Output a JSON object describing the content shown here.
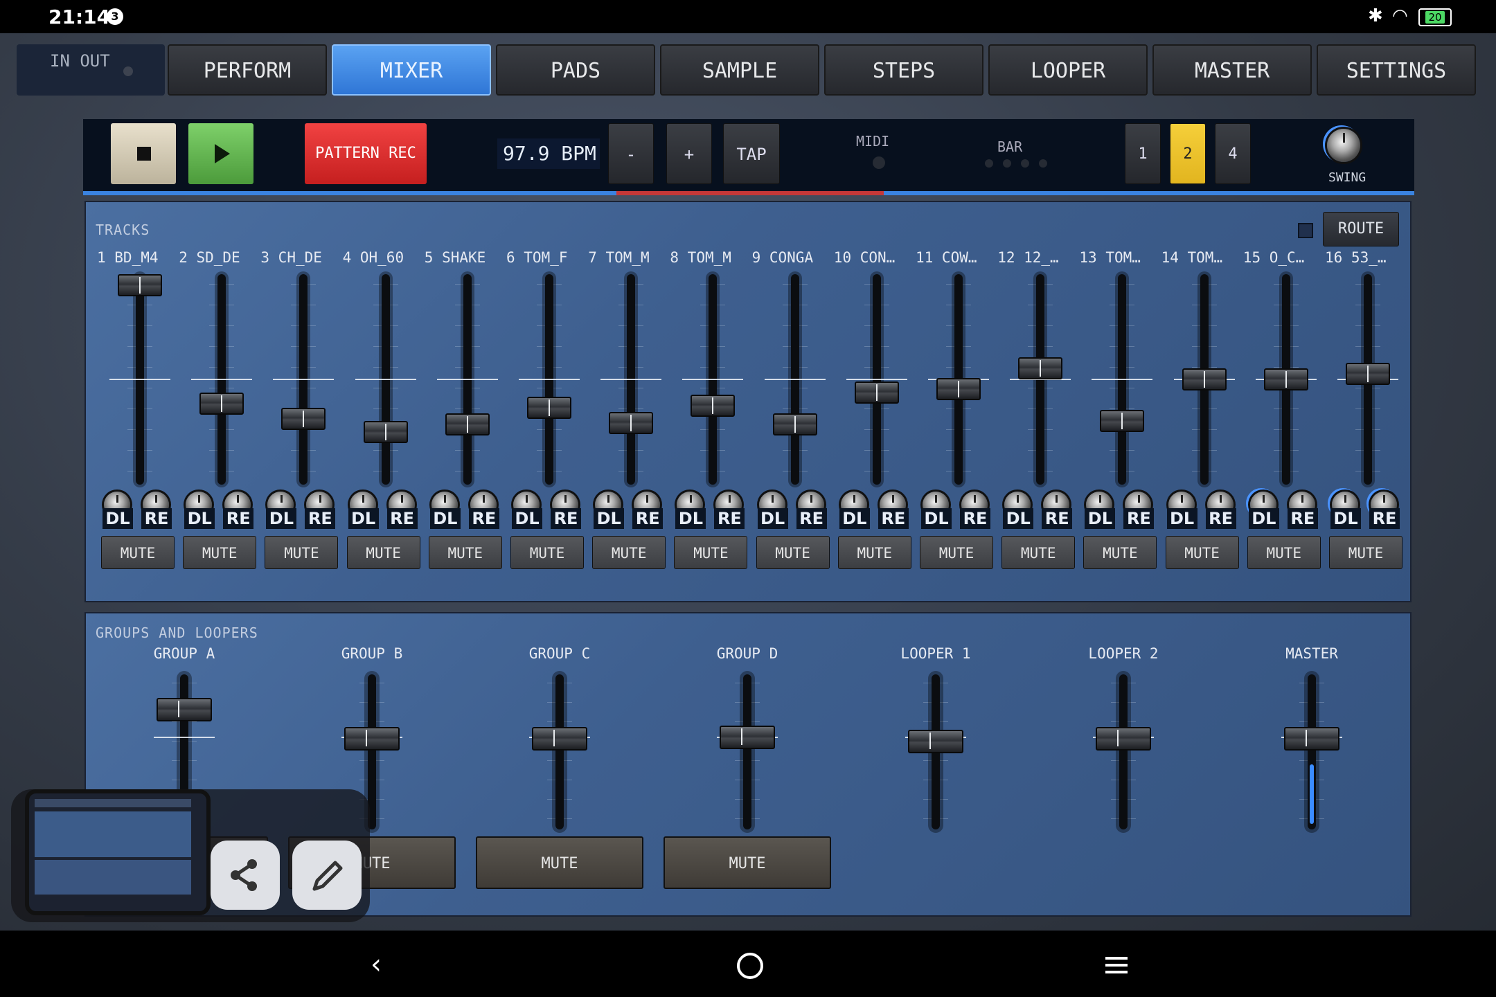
{
  "status": {
    "time": "21:14",
    "notification_count": "3",
    "battery": "20"
  },
  "nav": {
    "inout_label": "IN OUT",
    "tabs": [
      {
        "label": "PERFORM",
        "active": false
      },
      {
        "label": "MIXER",
        "active": true
      },
      {
        "label": "PADS",
        "active": false
      },
      {
        "label": "SAMPLE",
        "active": false
      },
      {
        "label": "STEPS",
        "active": false
      },
      {
        "label": "LOOPER",
        "active": false
      },
      {
        "label": "MASTER",
        "active": false
      },
      {
        "label": "SETTINGS",
        "active": false
      }
    ]
  },
  "transport": {
    "pattern_rec": "PATTERN REC",
    "bpm": "97.9 BPM",
    "minus": "-",
    "plus": "+",
    "tap": "TAP",
    "midi": "MIDI",
    "bar": "BAR",
    "bar_options": [
      "1",
      "2",
      "4"
    ],
    "bar_selected": "2",
    "swing": "SWING"
  },
  "tracks_panel": {
    "title": "TRACKS",
    "route": "ROUTE",
    "dl": "DL",
    "re": "RE",
    "mute": "MUTE",
    "tracks": [
      {
        "name": "1 BD_M4",
        "level": 1.0
      },
      {
        "name": "2 SD_DE",
        "level": 0.37
      },
      {
        "name": "3 CH_DE",
        "level": 0.29
      },
      {
        "name": "4 OH_60",
        "level": 0.22
      },
      {
        "name": "5 SHAKE",
        "level": 0.26
      },
      {
        "name": "6 TOM_F",
        "level": 0.35
      },
      {
        "name": "7 TOM_M",
        "level": 0.27
      },
      {
        "name": "8 TOM_M",
        "level": 0.36
      },
      {
        "name": "9 CONGA",
        "level": 0.26
      },
      {
        "name": "10 CON…",
        "level": 0.43
      },
      {
        "name": "11 COW…",
        "level": 0.45
      },
      {
        "name": "12 12_…",
        "level": 0.56
      },
      {
        "name": "13 TOM…",
        "level": 0.28
      },
      {
        "name": "14 TOM…",
        "level": 0.5
      },
      {
        "name": "15 O_C…",
        "level": 0.5
      },
      {
        "name": "16 53_…",
        "level": 0.53
      }
    ]
  },
  "groups_panel": {
    "title": "GROUPS AND LOOPERS",
    "mute": "MUTE",
    "strips": [
      {
        "name": "GROUP A",
        "level": 0.82
      },
      {
        "name": "GROUP B",
        "level": 0.6
      },
      {
        "name": "GROUP C",
        "level": 0.6
      },
      {
        "name": "GROUP D",
        "level": 0.61
      },
      {
        "name": "LOOPER 1",
        "level": 0.58
      },
      {
        "name": "LOOPER 2",
        "level": 0.6
      },
      {
        "name": "MASTER",
        "level": 0.6
      }
    ]
  },
  "overlay": {
    "share_icon": "share-icon",
    "edit_icon": "pencil-icon"
  },
  "colors": {
    "accent_blue": "#3a83e0",
    "record_red": "#e33333",
    "play_green": "#5fb04c",
    "bar_yellow": "#f0c72f"
  }
}
